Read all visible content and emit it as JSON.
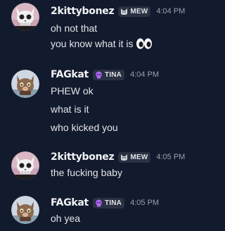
{
  "messages": [
    {
      "author": "2kittybonez",
      "tag": "MEW",
      "tag_icon": "cat-face-icon",
      "time": "4:04 PM",
      "avatar": "skull-cat-avatar",
      "lines": [
        "oh not that",
        "you know what it is"
      ],
      "emoji": "eyes-emoji"
    },
    {
      "author": "FAGkat",
      "tag": "TINA",
      "tag_icon": "skull-icon",
      "tag_color": "#b266ff",
      "time": "4:04 PM",
      "avatar": "brown-cat-avatar",
      "lines": [
        "PHEW ok",
        "what is it",
        "who kicked you"
      ]
    },
    {
      "author": "2kittybonez",
      "tag": "MEW",
      "tag_icon": "cat-face-icon",
      "time": "4:05 PM",
      "avatar": "skull-cat-avatar",
      "lines": [
        "the fucking baby"
      ]
    },
    {
      "author": "FAGkat",
      "tag": "TINA",
      "tag_icon": "skull-icon",
      "tag_color": "#b266ff",
      "time": "4:05 PM",
      "avatar": "brown-cat-avatar",
      "lines": [
        "oh yea"
      ]
    }
  ],
  "colors": {
    "background": "#121a2d",
    "username": "#f2f3f5",
    "text": "#e3e5e8",
    "timestamp": "#9aa0aa",
    "tag_bg": "#2a3142"
  }
}
